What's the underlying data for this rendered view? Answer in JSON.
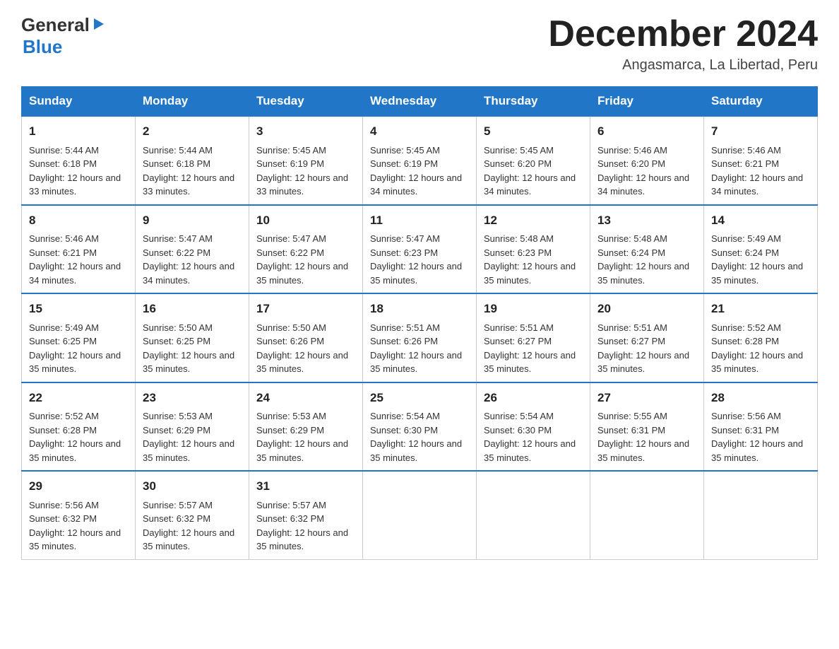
{
  "header": {
    "logo": {
      "general": "General",
      "arrow": "▶",
      "blue": "Blue"
    },
    "title": "December 2024",
    "location": "Angasmarca, La Libertad, Peru"
  },
  "days_of_week": [
    "Sunday",
    "Monday",
    "Tuesday",
    "Wednesday",
    "Thursday",
    "Friday",
    "Saturday"
  ],
  "weeks": [
    [
      {
        "day": "1",
        "sunrise": "5:44 AM",
        "sunset": "6:18 PM",
        "daylight": "12 hours and 33 minutes."
      },
      {
        "day": "2",
        "sunrise": "5:44 AM",
        "sunset": "6:18 PM",
        "daylight": "12 hours and 33 minutes."
      },
      {
        "day": "3",
        "sunrise": "5:45 AM",
        "sunset": "6:19 PM",
        "daylight": "12 hours and 33 minutes."
      },
      {
        "day": "4",
        "sunrise": "5:45 AM",
        "sunset": "6:19 PM",
        "daylight": "12 hours and 34 minutes."
      },
      {
        "day": "5",
        "sunrise": "5:45 AM",
        "sunset": "6:20 PM",
        "daylight": "12 hours and 34 minutes."
      },
      {
        "day": "6",
        "sunrise": "5:46 AM",
        "sunset": "6:20 PM",
        "daylight": "12 hours and 34 minutes."
      },
      {
        "day": "7",
        "sunrise": "5:46 AM",
        "sunset": "6:21 PM",
        "daylight": "12 hours and 34 minutes."
      }
    ],
    [
      {
        "day": "8",
        "sunrise": "5:46 AM",
        "sunset": "6:21 PM",
        "daylight": "12 hours and 34 minutes."
      },
      {
        "day": "9",
        "sunrise": "5:47 AM",
        "sunset": "6:22 PM",
        "daylight": "12 hours and 34 minutes."
      },
      {
        "day": "10",
        "sunrise": "5:47 AM",
        "sunset": "6:22 PM",
        "daylight": "12 hours and 35 minutes."
      },
      {
        "day": "11",
        "sunrise": "5:47 AM",
        "sunset": "6:23 PM",
        "daylight": "12 hours and 35 minutes."
      },
      {
        "day": "12",
        "sunrise": "5:48 AM",
        "sunset": "6:23 PM",
        "daylight": "12 hours and 35 minutes."
      },
      {
        "day": "13",
        "sunrise": "5:48 AM",
        "sunset": "6:24 PM",
        "daylight": "12 hours and 35 minutes."
      },
      {
        "day": "14",
        "sunrise": "5:49 AM",
        "sunset": "6:24 PM",
        "daylight": "12 hours and 35 minutes."
      }
    ],
    [
      {
        "day": "15",
        "sunrise": "5:49 AM",
        "sunset": "6:25 PM",
        "daylight": "12 hours and 35 minutes."
      },
      {
        "day": "16",
        "sunrise": "5:50 AM",
        "sunset": "6:25 PM",
        "daylight": "12 hours and 35 minutes."
      },
      {
        "day": "17",
        "sunrise": "5:50 AM",
        "sunset": "6:26 PM",
        "daylight": "12 hours and 35 minutes."
      },
      {
        "day": "18",
        "sunrise": "5:51 AM",
        "sunset": "6:26 PM",
        "daylight": "12 hours and 35 minutes."
      },
      {
        "day": "19",
        "sunrise": "5:51 AM",
        "sunset": "6:27 PM",
        "daylight": "12 hours and 35 minutes."
      },
      {
        "day": "20",
        "sunrise": "5:51 AM",
        "sunset": "6:27 PM",
        "daylight": "12 hours and 35 minutes."
      },
      {
        "day": "21",
        "sunrise": "5:52 AM",
        "sunset": "6:28 PM",
        "daylight": "12 hours and 35 minutes."
      }
    ],
    [
      {
        "day": "22",
        "sunrise": "5:52 AM",
        "sunset": "6:28 PM",
        "daylight": "12 hours and 35 minutes."
      },
      {
        "day": "23",
        "sunrise": "5:53 AM",
        "sunset": "6:29 PM",
        "daylight": "12 hours and 35 minutes."
      },
      {
        "day": "24",
        "sunrise": "5:53 AM",
        "sunset": "6:29 PM",
        "daylight": "12 hours and 35 minutes."
      },
      {
        "day": "25",
        "sunrise": "5:54 AM",
        "sunset": "6:30 PM",
        "daylight": "12 hours and 35 minutes."
      },
      {
        "day": "26",
        "sunrise": "5:54 AM",
        "sunset": "6:30 PM",
        "daylight": "12 hours and 35 minutes."
      },
      {
        "day": "27",
        "sunrise": "5:55 AM",
        "sunset": "6:31 PM",
        "daylight": "12 hours and 35 minutes."
      },
      {
        "day": "28",
        "sunrise": "5:56 AM",
        "sunset": "6:31 PM",
        "daylight": "12 hours and 35 minutes."
      }
    ],
    [
      {
        "day": "29",
        "sunrise": "5:56 AM",
        "sunset": "6:32 PM",
        "daylight": "12 hours and 35 minutes."
      },
      {
        "day": "30",
        "sunrise": "5:57 AM",
        "sunset": "6:32 PM",
        "daylight": "12 hours and 35 minutes."
      },
      {
        "day": "31",
        "sunrise": "5:57 AM",
        "sunset": "6:32 PM",
        "daylight": "12 hours and 35 minutes."
      },
      null,
      null,
      null,
      null
    ]
  ]
}
